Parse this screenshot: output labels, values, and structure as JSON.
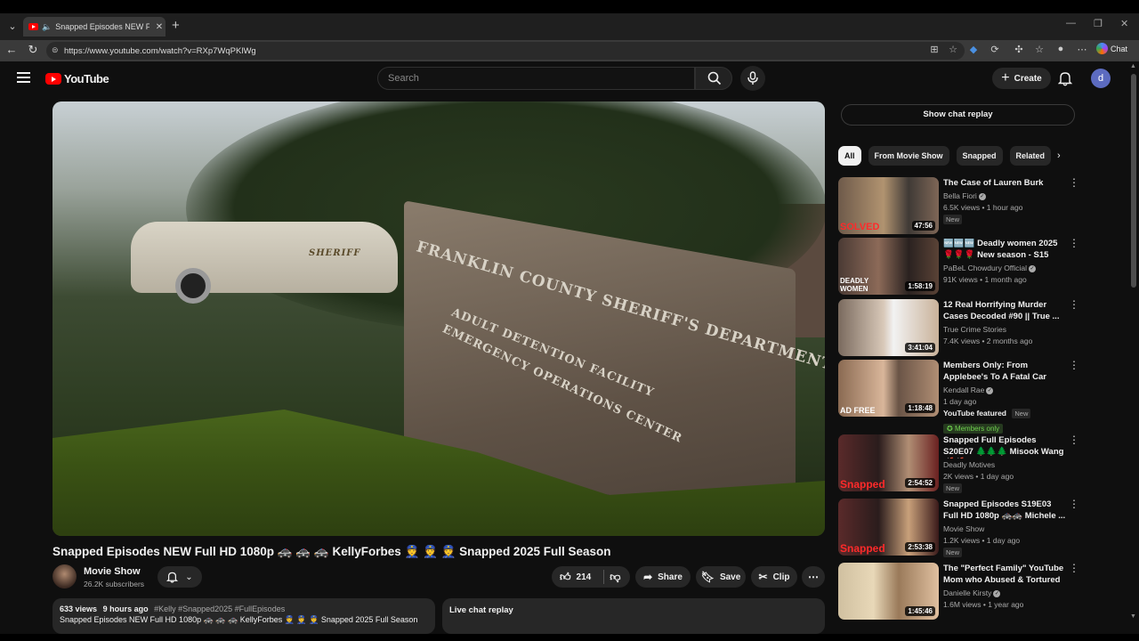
{
  "browser": {
    "tab_title": "Snapped Episodes NEW Full H",
    "url": "https://www.youtube.com/watch?v=RXp7WqPKlWg",
    "copilot_label": "Chat"
  },
  "header": {
    "logo_text": "YouTube",
    "search_placeholder": "Search",
    "create_label": "Create",
    "avatar_letter": "d"
  },
  "video": {
    "sign_line1": "FRANKLIN COUNTY SHERIFF'S DEPARTMENT",
    "sign_line2": "ADULT DETENTION FACILITY",
    "sign_line3": "EMERGENCY OPERATIONS CENTER",
    "car_text": "SHERIFF",
    "title": "Snapped Episodes NEW Full HD 1080p 🚓 🚓 🚓 KellyForbes 👮 👮 👮 Snapped 2025 Full Season",
    "channel": "Movie Show",
    "subscribers": "26.2K subscribers",
    "likes": "214",
    "share_label": "Share",
    "save_label": "Save",
    "clip_label": "Clip",
    "views": "633 views",
    "time_ago": "9 hours ago",
    "hashtags": "#Kelly #Snapped2025 #FullEpisodes",
    "desc_snippet": "Snapped Episodes NEW Full HD 1080p 🚓 🚓 🚓 KellyForbes 👮 👮 👮 Snapped 2025 Full Season",
    "live_chat_label": "Live chat replay"
  },
  "sidebar": {
    "chat_replay_btn": "Show chat replay",
    "chips": [
      "All",
      "From Movie Show",
      "Snapped",
      "Related"
    ],
    "recs": [
      {
        "title": "The Case of Lauren Burk",
        "channel": "Bella Fiori",
        "meta": "6.5K views • 1 hour ago",
        "badge": "New",
        "duration": "47:56",
        "thumb_label": "SOLVED"
      },
      {
        "title": "🆕🆕🆕 Deadly women 2025 🌹🌹🌹 New season - S15 E08| ...",
        "channel": "PaBeL Chowdury Official",
        "meta": "91K views • 1 month ago",
        "badge": "",
        "duration": "1:58:19",
        "thumb_label": "DEADLY WOMEN"
      },
      {
        "title": "12 Real Horrifying Murder Cases Decoded #90 || True ...",
        "channel": "True Crime Stories",
        "meta": "7.4K views • 2 months ago",
        "badge": "",
        "duration": "3:41:04",
        "thumb_label": ""
      },
      {
        "title": "Members Only: From Applebee's To A Fatal Car Crash... The ...",
        "channel": "Kendall Rae",
        "meta": "1 day ago",
        "featured": "YouTube featured",
        "badge": "New",
        "members": "Members only",
        "duration": "1:18:48",
        "thumb_label": "AD FREE"
      },
      {
        "title": "Snapped Full Episodes S20E07 🌲🌲🌲 Misook Wang 🚀🚀 ...",
        "channel": "Deadly Motives",
        "meta": "2K views • 1 day ago",
        "badge": "New",
        "duration": "2:54:52",
        "thumb_label": "Snapped"
      },
      {
        "title": "Snapped Episodes S19E03 Full HD 1080p 🚓🚓 Michele ...",
        "channel": "Movie Show",
        "meta": "1.2K views • 1 day ago",
        "badge": "New",
        "duration": "2:53:38",
        "thumb_label": "Snapped"
      },
      {
        "title": "The \"Perfect Family\" YouTube Mom who Abused & Tortured ...",
        "channel": "Danielle Kirsty",
        "meta": "1.6M views • 1 year ago",
        "badge": "",
        "duration": "1:45:46",
        "thumb_label": ""
      }
    ]
  },
  "colors": {
    "bg": "#0f0f0f",
    "accent": "#ff0000",
    "pill": "#272727"
  }
}
